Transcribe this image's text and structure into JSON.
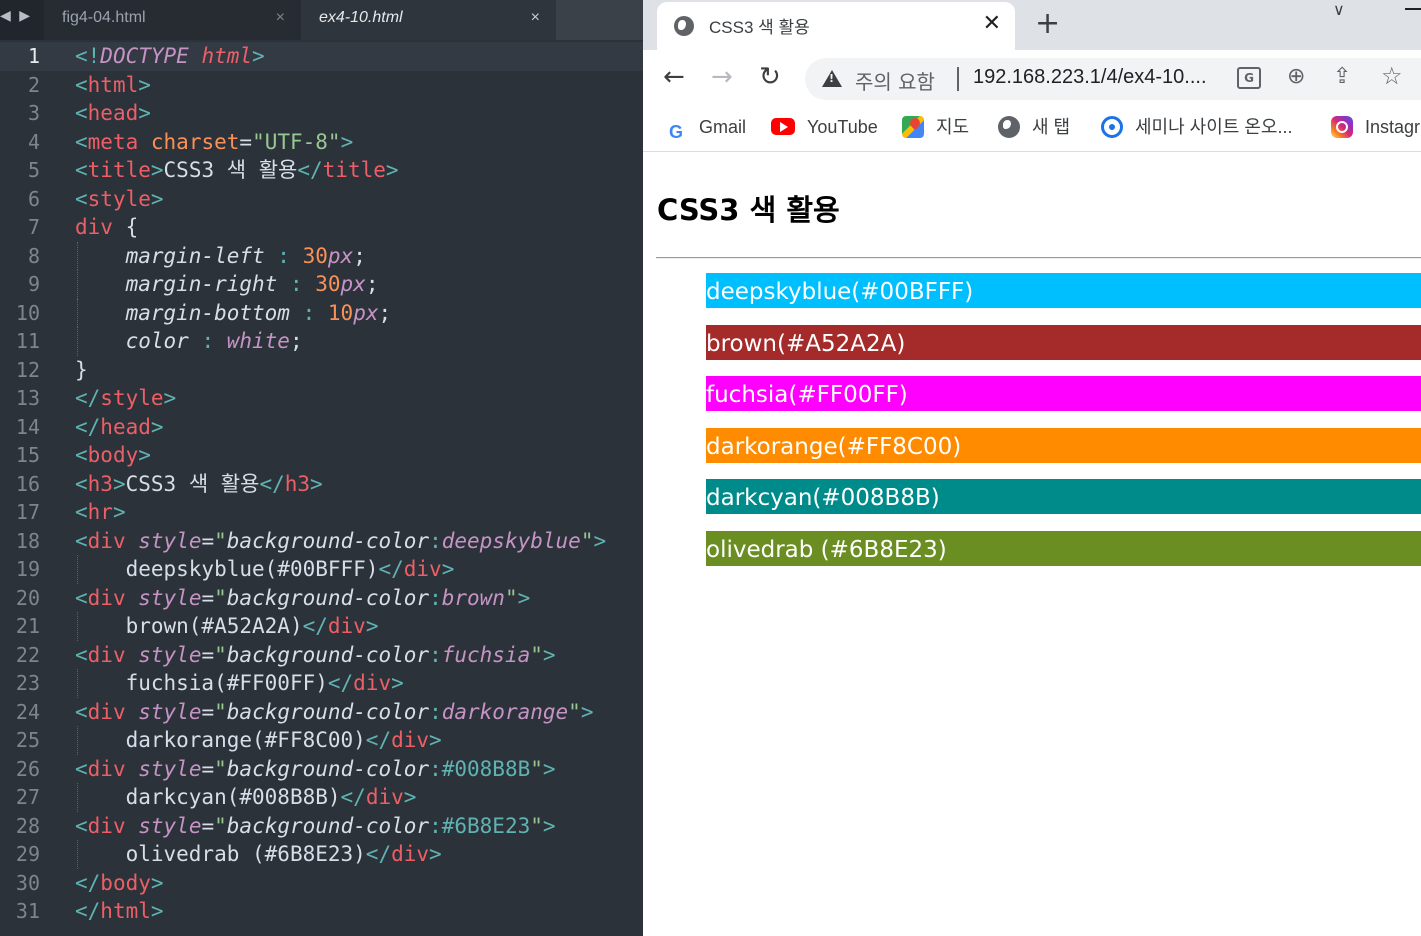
{
  "editor": {
    "tabs": [
      {
        "label": "fig4-04.html",
        "close": "×"
      },
      {
        "label": "ex4-10.html",
        "close": "×"
      }
    ],
    "nav_arrows": "◀ ▶",
    "line_numbers": [
      "1",
      "2",
      "3",
      "4",
      "5",
      "6",
      "7",
      "8",
      "9",
      "10",
      "11",
      "12",
      "13",
      "14",
      "15",
      "16",
      "17",
      "18",
      "19",
      "20",
      "21",
      "22",
      "23",
      "24",
      "25",
      "26",
      "27",
      "28",
      "29",
      "30",
      "31"
    ],
    "code": {
      "l1_a": "<!",
      "l1_b": "DOCTYPE",
      "l1_c": " ",
      "l1_d": "html",
      "l1_e": ">",
      "l2": "html",
      "l3": "head",
      "l4_tag": "meta",
      "l4_attr": "charset",
      "l4_eq": "=",
      "l4_val": "\"UTF-8\"",
      "l5_open": "title",
      "l5_text": "CSS3 색 활용",
      "l5_close": "title",
      "l6": "style",
      "l7_sel": "div",
      "l7_brace": " {",
      "l8_prop": "margin-left",
      "l8_colon": " : ",
      "l8_num": "30",
      "l8_unit": "px",
      "l8_semi": ";",
      "l9_prop": "margin-right",
      "l9_colon": " : ",
      "l9_num": "30",
      "l9_unit": "px",
      "l9_semi": ";",
      "l10_prop": "margin-bottom",
      "l10_colon": " : ",
      "l10_num": "10",
      "l10_unit": "px",
      "l10_semi": ";",
      "l11_prop": "color",
      "l11_colon": " : ",
      "l11_val": "white",
      "l11_semi": ";",
      "l12": "}",
      "l13": "style",
      "l14": "head",
      "l15": "body",
      "l16_open": "h3",
      "l16_text": "CSS3 색 활용",
      "l16_close": "h3",
      "l17": "hr",
      "div_tag": "div",
      "style_attr": "style",
      "bg_prop": "background-color",
      "colon": ":",
      "l18_val": "deepskyblue",
      "l19_text": "deepskyblue(#00BFFF)",
      "l20_val": "brown",
      "l21_text": "brown(#A52A2A)",
      "l22_val": "fuchsia",
      "l23_text": "fuchsia(#FF00FF)",
      "l24_val": "darkorange",
      "l25_text": "darkorange(#FF8C00)",
      "l26_val": "#008B8B",
      "l27_text": "darkcyan(#008B8B)",
      "l28_val": "#6B8E23",
      "l29_text": "olivedrab (#6B8E23)",
      "l30": "body",
      "l31": "html"
    }
  },
  "browser": {
    "tab_title": "CSS3 색 활용",
    "tab_close": "✕",
    "new_tab": "+",
    "chevron": "∨",
    "back": "←",
    "forward": "→",
    "reload": "↻",
    "security_text": "주의 요함",
    "url": "192.168.223.1/4/ex4-10....",
    "translate_icon": "G",
    "zoom_icon": "⊕",
    "share_icon": "⇪",
    "star_icon": "☆",
    "bookmarks": [
      {
        "label": "Gmail",
        "icon": "google-icon",
        "glyph": "G"
      },
      {
        "label": "YouTube",
        "icon": "youtube-icon"
      },
      {
        "label": "지도",
        "icon": "maps-icon"
      },
      {
        "label": "새 탭",
        "icon": "globe-icon"
      },
      {
        "label": "세미나 사이트 온오...",
        "icon": "ring-icon"
      },
      {
        "label": "Instagr",
        "icon": "instagram-icon"
      }
    ],
    "page": {
      "heading": "CSS3 색 활용",
      "color_boxes": [
        {
          "label": "deepskyblue(#00BFFF)",
          "color": "#00BFFF"
        },
        {
          "label": "brown(#A52A2A)",
          "color": "#A52A2A"
        },
        {
          "label": "fuchsia(#FF00FF)",
          "color": "#FF00FF"
        },
        {
          "label": "darkorange(#FF8C00)",
          "color": "#FF8C00"
        },
        {
          "label": "darkcyan(#008B8B)",
          "color": "#008B8B"
        },
        {
          "label": "olivedrab (#6B8E23)",
          "color": "#6B8E23"
        }
      ]
    }
  }
}
